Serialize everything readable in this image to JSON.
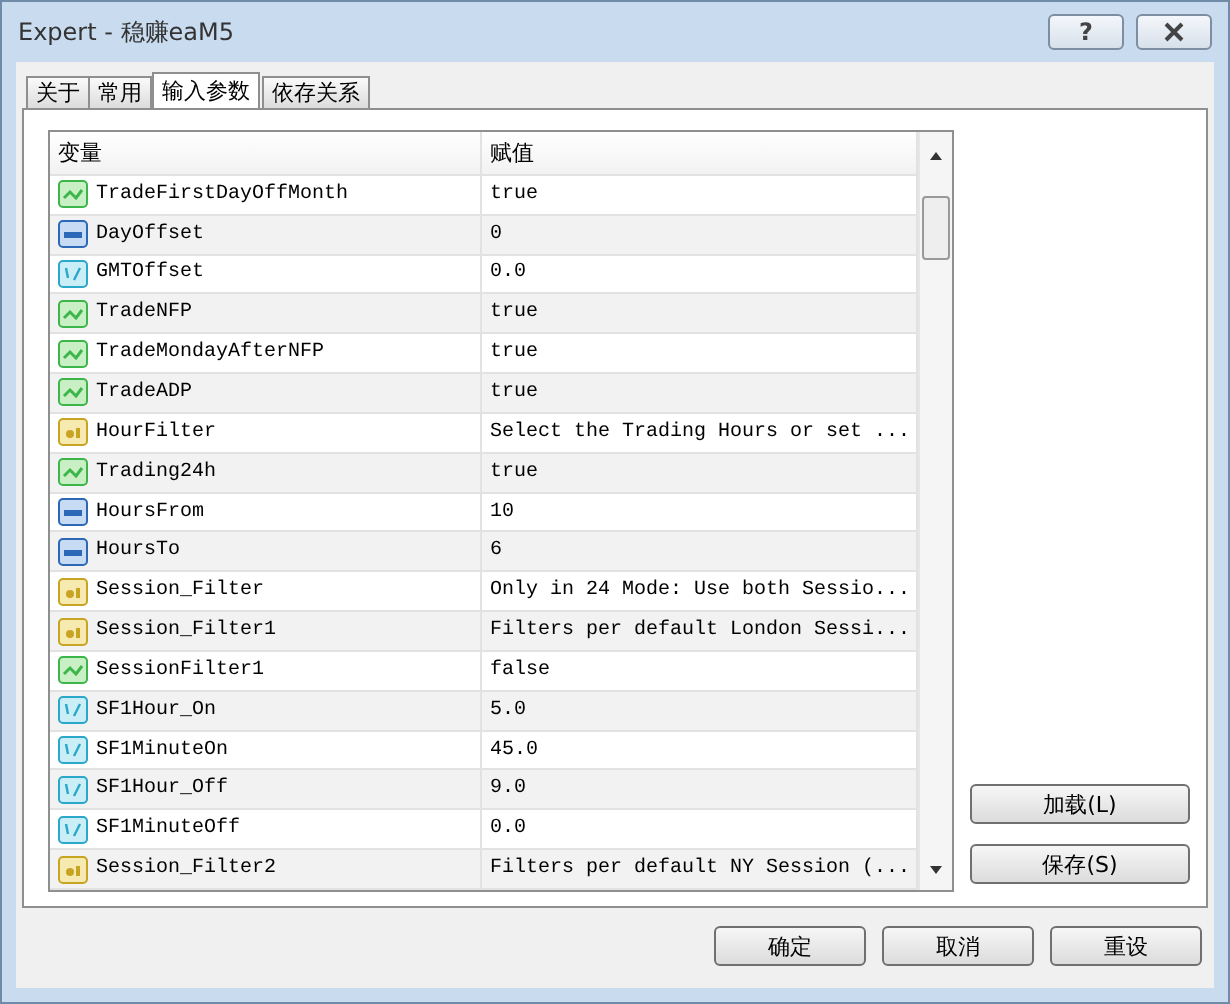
{
  "window": {
    "title": "Expert - 稳赚eaM5",
    "help_button": "?"
  },
  "tabs": [
    {
      "label": "关于",
      "selected": false
    },
    {
      "label": "常用",
      "selected": false
    },
    {
      "label": "输入参数",
      "selected": true
    },
    {
      "label": "依存关系",
      "selected": false
    }
  ],
  "table": {
    "columns": [
      "变量",
      "赋值"
    ],
    "rows": [
      {
        "kind": "bool",
        "name": "TradeFirstDayOffMonth",
        "value": "true"
      },
      {
        "kind": "int",
        "name": "DayOffset",
        "value": "0"
      },
      {
        "kind": "double",
        "name": "GMTOffset",
        "value": "0.0"
      },
      {
        "kind": "bool",
        "name": "TradeNFP",
        "value": "true"
      },
      {
        "kind": "bool",
        "name": "TradeMondayAfterNFP",
        "value": "true"
      },
      {
        "kind": "bool",
        "name": "TradeADP",
        "value": "true"
      },
      {
        "kind": "string",
        "name": "HourFilter",
        "value": "Select the Trading Hours or set ..."
      },
      {
        "kind": "bool",
        "name": "Trading24h",
        "value": "true"
      },
      {
        "kind": "int",
        "name": "HoursFrom",
        "value": "10"
      },
      {
        "kind": "int",
        "name": "HoursTo",
        "value": "6"
      },
      {
        "kind": "string",
        "name": "Session_Filter",
        "value": "Only in 24 Mode: Use both Sessio..."
      },
      {
        "kind": "string",
        "name": "Session_Filter1",
        "value": "Filters per default London Sessi..."
      },
      {
        "kind": "bool",
        "name": "SessionFilter1",
        "value": "false"
      },
      {
        "kind": "double",
        "name": "SF1Hour_On",
        "value": "5.0"
      },
      {
        "kind": "double",
        "name": "SF1MinuteOn",
        "value": "45.0"
      },
      {
        "kind": "double",
        "name": "SF1Hour_Off",
        "value": "9.0"
      },
      {
        "kind": "double",
        "name": "SF1MinuteOff",
        "value": "0.0"
      },
      {
        "kind": "string",
        "name": "Session_Filter2",
        "value": "Filters per default NY Session (..."
      }
    ]
  },
  "side_buttons": [
    "加载(L)",
    "保存(S)"
  ],
  "dialog_buttons": [
    "确定",
    "取消",
    "重设"
  ]
}
